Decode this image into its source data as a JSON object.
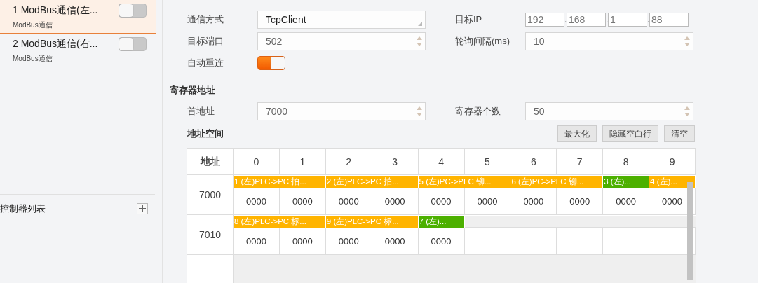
{
  "sidebar": {
    "items": [
      {
        "title": "1 ModBus通信(左...",
        "subtitle": "ModBus通信",
        "selected": true,
        "on": false
      },
      {
        "title": "2 ModBus通信(右...",
        "subtitle": "ModBus通信",
        "selected": false,
        "on": false
      }
    ],
    "footer": {
      "label": "控制器列表"
    }
  },
  "connection": {
    "rows": [
      [
        {
          "label": "通信方式",
          "kind": "select",
          "value": "TcpClient"
        },
        {
          "label": "目标IP",
          "kind": "ip",
          "parts": [
            "192",
            "168",
            "1",
            "88"
          ],
          "separator": "."
        }
      ],
      [
        {
          "label": "目标端口",
          "kind": "spin",
          "value": "502"
        },
        {
          "label": "轮询间隔(ms)",
          "kind": "spin",
          "value": "10"
        }
      ],
      [
        {
          "label": "自动重连",
          "kind": "toggle",
          "on": true
        }
      ]
    ]
  },
  "register": {
    "title": "寄存器地址",
    "rows": [
      [
        {
          "label": "首地址",
          "kind": "spin",
          "value": "7000"
        },
        {
          "label": "寄存器个数",
          "kind": "spin",
          "value": "50"
        }
      ]
    ]
  },
  "address_space": {
    "title": "地址空间",
    "buttons": [
      "最大化",
      "隐藏空白行",
      "清空"
    ],
    "table": {
      "columns": [
        "地址",
        "0",
        "1",
        "2",
        "3",
        "4",
        "5",
        "6",
        "7",
        "8",
        "9"
      ],
      "rows": [
        {
          "address": "7000",
          "tags": [
            {
              "label": "1 (左)PLC->PC 拍...",
              "kind": "double",
              "color": "#ffb400"
            },
            {
              "label": "2 (左)PLC->PC 拍...",
              "kind": "double",
              "color": "#ffb400"
            },
            {
              "label": "5 (左)PC->PLC 铆...",
              "kind": "double",
              "color": "#ffb400"
            },
            {
              "label": "6 (左)PC->PLC 铆...",
              "kind": "double",
              "color": "#ffb400"
            },
            {
              "label": "3 (左)...",
              "kind": "single",
              "color": "#4cb000"
            },
            {
              "label": "4 (左)...",
              "kind": "single",
              "color": "#ffb400"
            }
          ],
          "values": [
            "0000",
            "0000",
            "0000",
            "0000",
            "0000",
            "0000",
            "0000",
            "0000",
            "0000",
            "0000"
          ]
        },
        {
          "address": "7010",
          "tags": [
            {
              "label": "8 (左)PLC->PC 标...",
              "kind": "double",
              "color": "#ffb400"
            },
            {
              "label": "9 (左)PLC->PC 标...",
              "kind": "double",
              "color": "#ffb400"
            },
            {
              "label": "7 (左)...",
              "kind": "single",
              "color": "#4cb000"
            }
          ],
          "values": [
            "0000",
            "0000",
            "0000",
            "0000",
            "0000"
          ]
        }
      ]
    }
  }
}
